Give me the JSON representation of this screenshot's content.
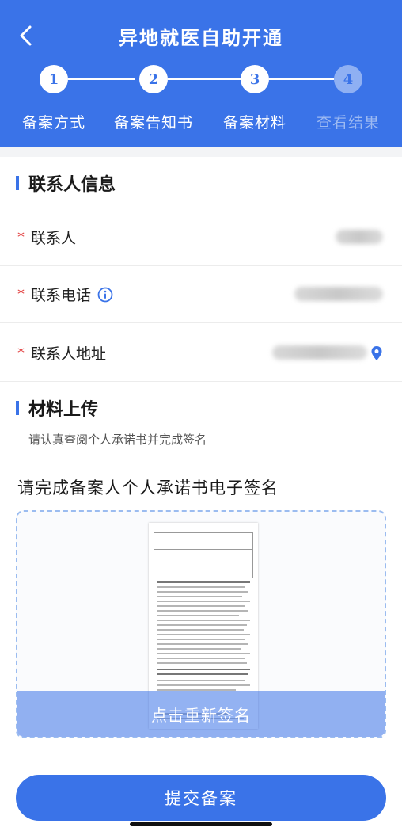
{
  "header": {
    "title": "异地就医自助开通",
    "back_icon": "chevron-left-icon"
  },
  "steps": [
    {
      "number": "1",
      "label": "备案方式",
      "active": true
    },
    {
      "number": "2",
      "label": "备案告知书",
      "active": true
    },
    {
      "number": "3",
      "label": "备案材料",
      "active": true
    },
    {
      "number": "4",
      "label": "查看结果",
      "active": false
    }
  ],
  "contact_section": {
    "title": "联系人信息",
    "fields": [
      {
        "label": "联系人",
        "required": true,
        "value": ""
      },
      {
        "label": "联系电话",
        "required": true,
        "value": "",
        "info_icon": "info-icon"
      },
      {
        "label": "联系人地址",
        "required": true,
        "value": "",
        "trailing_icon": "location-pin-icon"
      }
    ]
  },
  "material_section": {
    "title": "材料上传",
    "hint": "请认真查阅个人承诺书并完成签名",
    "sign_title": "请完成备案人个人承诺书电子签名",
    "resign_label": "点击重新签名"
  },
  "submit_label": "提交备案",
  "colors": {
    "primary": "#3a73e8",
    "required": "#e23b3b",
    "inactive_step": "#8fb0f3"
  }
}
